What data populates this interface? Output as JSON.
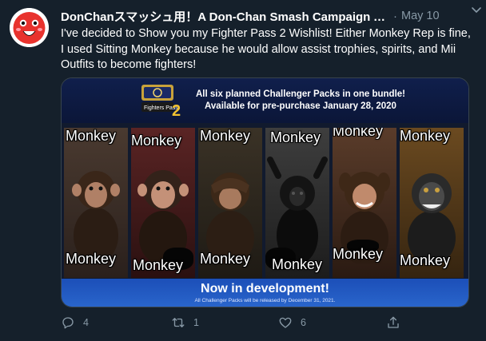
{
  "tweet": {
    "display_name": "DonChanスマッシュ用！A Don-Chan Smash Campaign Aco...",
    "separator": "·",
    "date": "May 10",
    "text": "I've decided to Show you my Fighter Pass 2 Wishlist! Either Monkey Rep is fine, I used Sitting Monkey because he would allow assist trophies, spirits, and Mii Outfits to become fighters!"
  },
  "media": {
    "headline_line1": "All six planned Challenger Packs in one bundle!",
    "headline_line2": "Available for pre-purchase January 28, 2020",
    "logo_caption": "Fighters Pass",
    "logo_number": "2",
    "panels": [
      {
        "top_label": "Monkey",
        "bottom_label": "Monkey"
      },
      {
        "top_label": "Monkey",
        "bottom_label": "Monkey"
      },
      {
        "top_label": "Monkey",
        "bottom_label": "Monkey"
      },
      {
        "top_label": "Monkey",
        "bottom_label": "Monkey"
      },
      {
        "top_label": "Monkey",
        "bottom_label": "Monkey"
      },
      {
        "top_label": "Monkey",
        "bottom_label": "Monkey"
      }
    ],
    "dev_text": "Now in development!",
    "fine_print": "All Challenger Packs will be released by December 31, 2021."
  },
  "actions": {
    "reply_count": "4",
    "retweet_count": "1",
    "like_count": "6"
  },
  "colors": {
    "background": "#15202b",
    "secondary_text": "#8899a6",
    "avatar_red": "#e8322d"
  }
}
